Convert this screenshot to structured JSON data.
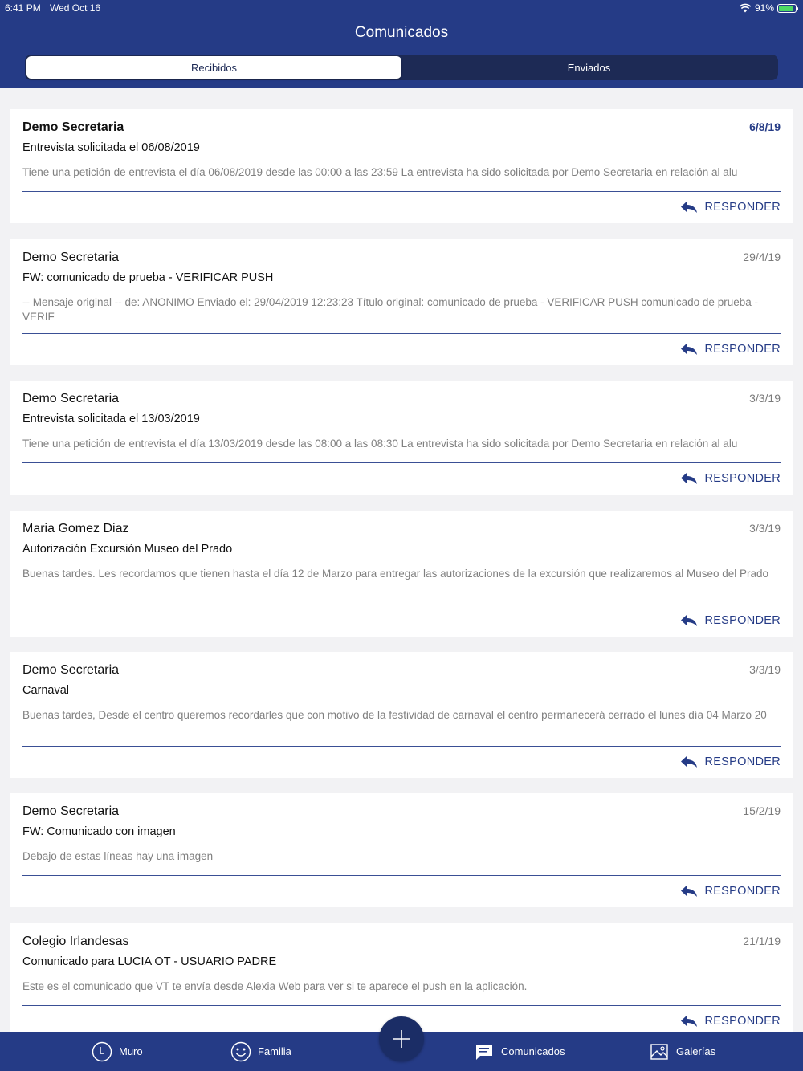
{
  "status": {
    "time": "6:41 PM",
    "date": "Wed Oct 16",
    "battery": "91%"
  },
  "header": {
    "title": "Comunicados",
    "tabs": [
      "Recibidos",
      "Enviados"
    ],
    "active_tab": "Recibidos"
  },
  "reply_label": "RESPONDER",
  "messages": [
    {
      "from": "Demo Secretaria",
      "date": "6/8/19",
      "subject": "Entrevista solicitada el 06/08/2019",
      "preview": "Tiene una petición de entrevista el día 06/08/2019 desde las 00:00 a las 23:59 La entrevista ha sido solicitada por Demo Secretaria en relación al alu",
      "unread": true
    },
    {
      "from": "Demo Secretaria",
      "date": "29/4/19",
      "subject": "FW: comunicado de prueba  - VERIFICAR PUSH",
      "preview": "-- Mensaje original -- de: ANONIMO Enviado el: 29/04/2019 12:23:23 Título original: comunicado de prueba - VERIFICAR PUSH comunicado de prueba - VERIF",
      "unread": false
    },
    {
      "from": "Demo Secretaria",
      "date": "3/3/19",
      "subject": "Entrevista solicitada el 13/03/2019",
      "preview": "Tiene una petición de entrevista el día 13/03/2019 desde las 08:00 a las 08:30 La entrevista ha sido solicitada por Demo Secretaria en relación al alu",
      "unread": false
    },
    {
      "from": "Maria Gomez Diaz",
      "date": "3/3/19",
      "subject": "Autorización Excursión Museo del Prado",
      "preview": "Buenas tardes. Les recordamos que tienen hasta el día 12 de Marzo para entregar las autorizaciones de la excursión que realizaremos al Museo del Prado",
      "unread": false
    },
    {
      "from": "Demo Secretaria",
      "date": "3/3/19",
      "subject": "Carnaval",
      "preview": "Buenas tardes, Desde el centro queremos recordarles que con motivo de la festividad de carnaval el centro permanecerá cerrado el lunes día 04 Marzo 20",
      "unread": false
    },
    {
      "from": "Demo Secretaria",
      "date": "15/2/19",
      "subject": "FW: Comunicado con imagen",
      "preview": "Debajo de estas líneas hay una imagen",
      "unread": false
    },
    {
      "from": "Colegio Irlandesas",
      "date": "21/1/19",
      "subject": "Comunicado para LUCIA OT - USUARIO PADRE",
      "preview": "Este es el comunicado que VT te envía desde Alexia Web para ver si te aparece el push en la aplicación.",
      "unread": false
    }
  ],
  "tabbar": {
    "items": [
      {
        "label": "Muro",
        "icon": "clock-icon"
      },
      {
        "label": "Familia",
        "icon": "smiley-icon"
      },
      {
        "label": "Comunicados",
        "icon": "chat-bubble-icon"
      },
      {
        "label": "Galerías",
        "icon": "image-icon"
      }
    ],
    "fab_icon": "plus-icon"
  },
  "colors": {
    "brand": "#253b86",
    "tab_dark": "#1d2a55",
    "background": "#f2f2f4"
  }
}
